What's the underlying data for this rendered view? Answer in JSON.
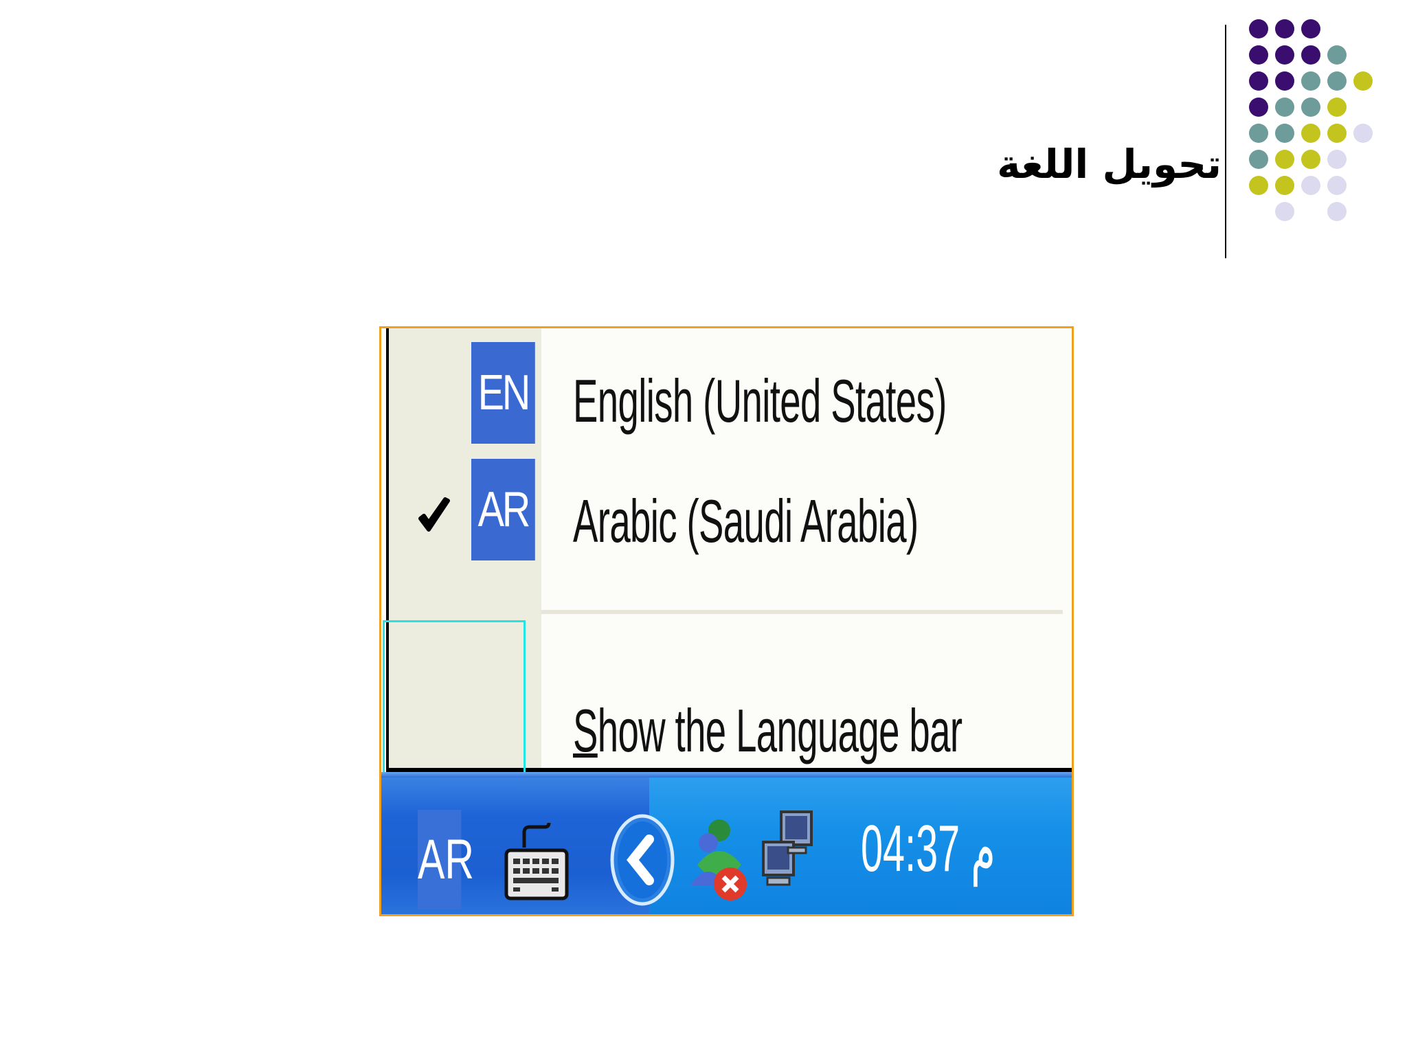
{
  "slide": {
    "title": "تحويل اللغة",
    "decoration_colors": [
      "#3a0e6e",
      "#6e9c9a",
      "#c4c41e",
      "#dcdaee"
    ]
  },
  "language_menu": {
    "items": [
      {
        "badge": "EN",
        "label": "English (United States)",
        "checked": false
      },
      {
        "badge": "AR",
        "label": "Arabic (Saudi Arabia)",
        "checked": true
      }
    ],
    "show_language_bar": {
      "mnemonic": "S",
      "rest": "how the Language bar"
    }
  },
  "taskbar": {
    "language_indicator": "AR",
    "clock": "04:37 م",
    "icons": [
      "keyboard-icon",
      "show-hidden-icons-chevron-icon",
      "messenger-status-icon",
      "network-icon"
    ]
  },
  "colors": {
    "frame_border": "#f0a020",
    "highlight": "#22e6e6",
    "badge_blue": "#3a6ad1",
    "taskbar_blue": "#1f64d6",
    "tray_blue": "#1590e8"
  }
}
